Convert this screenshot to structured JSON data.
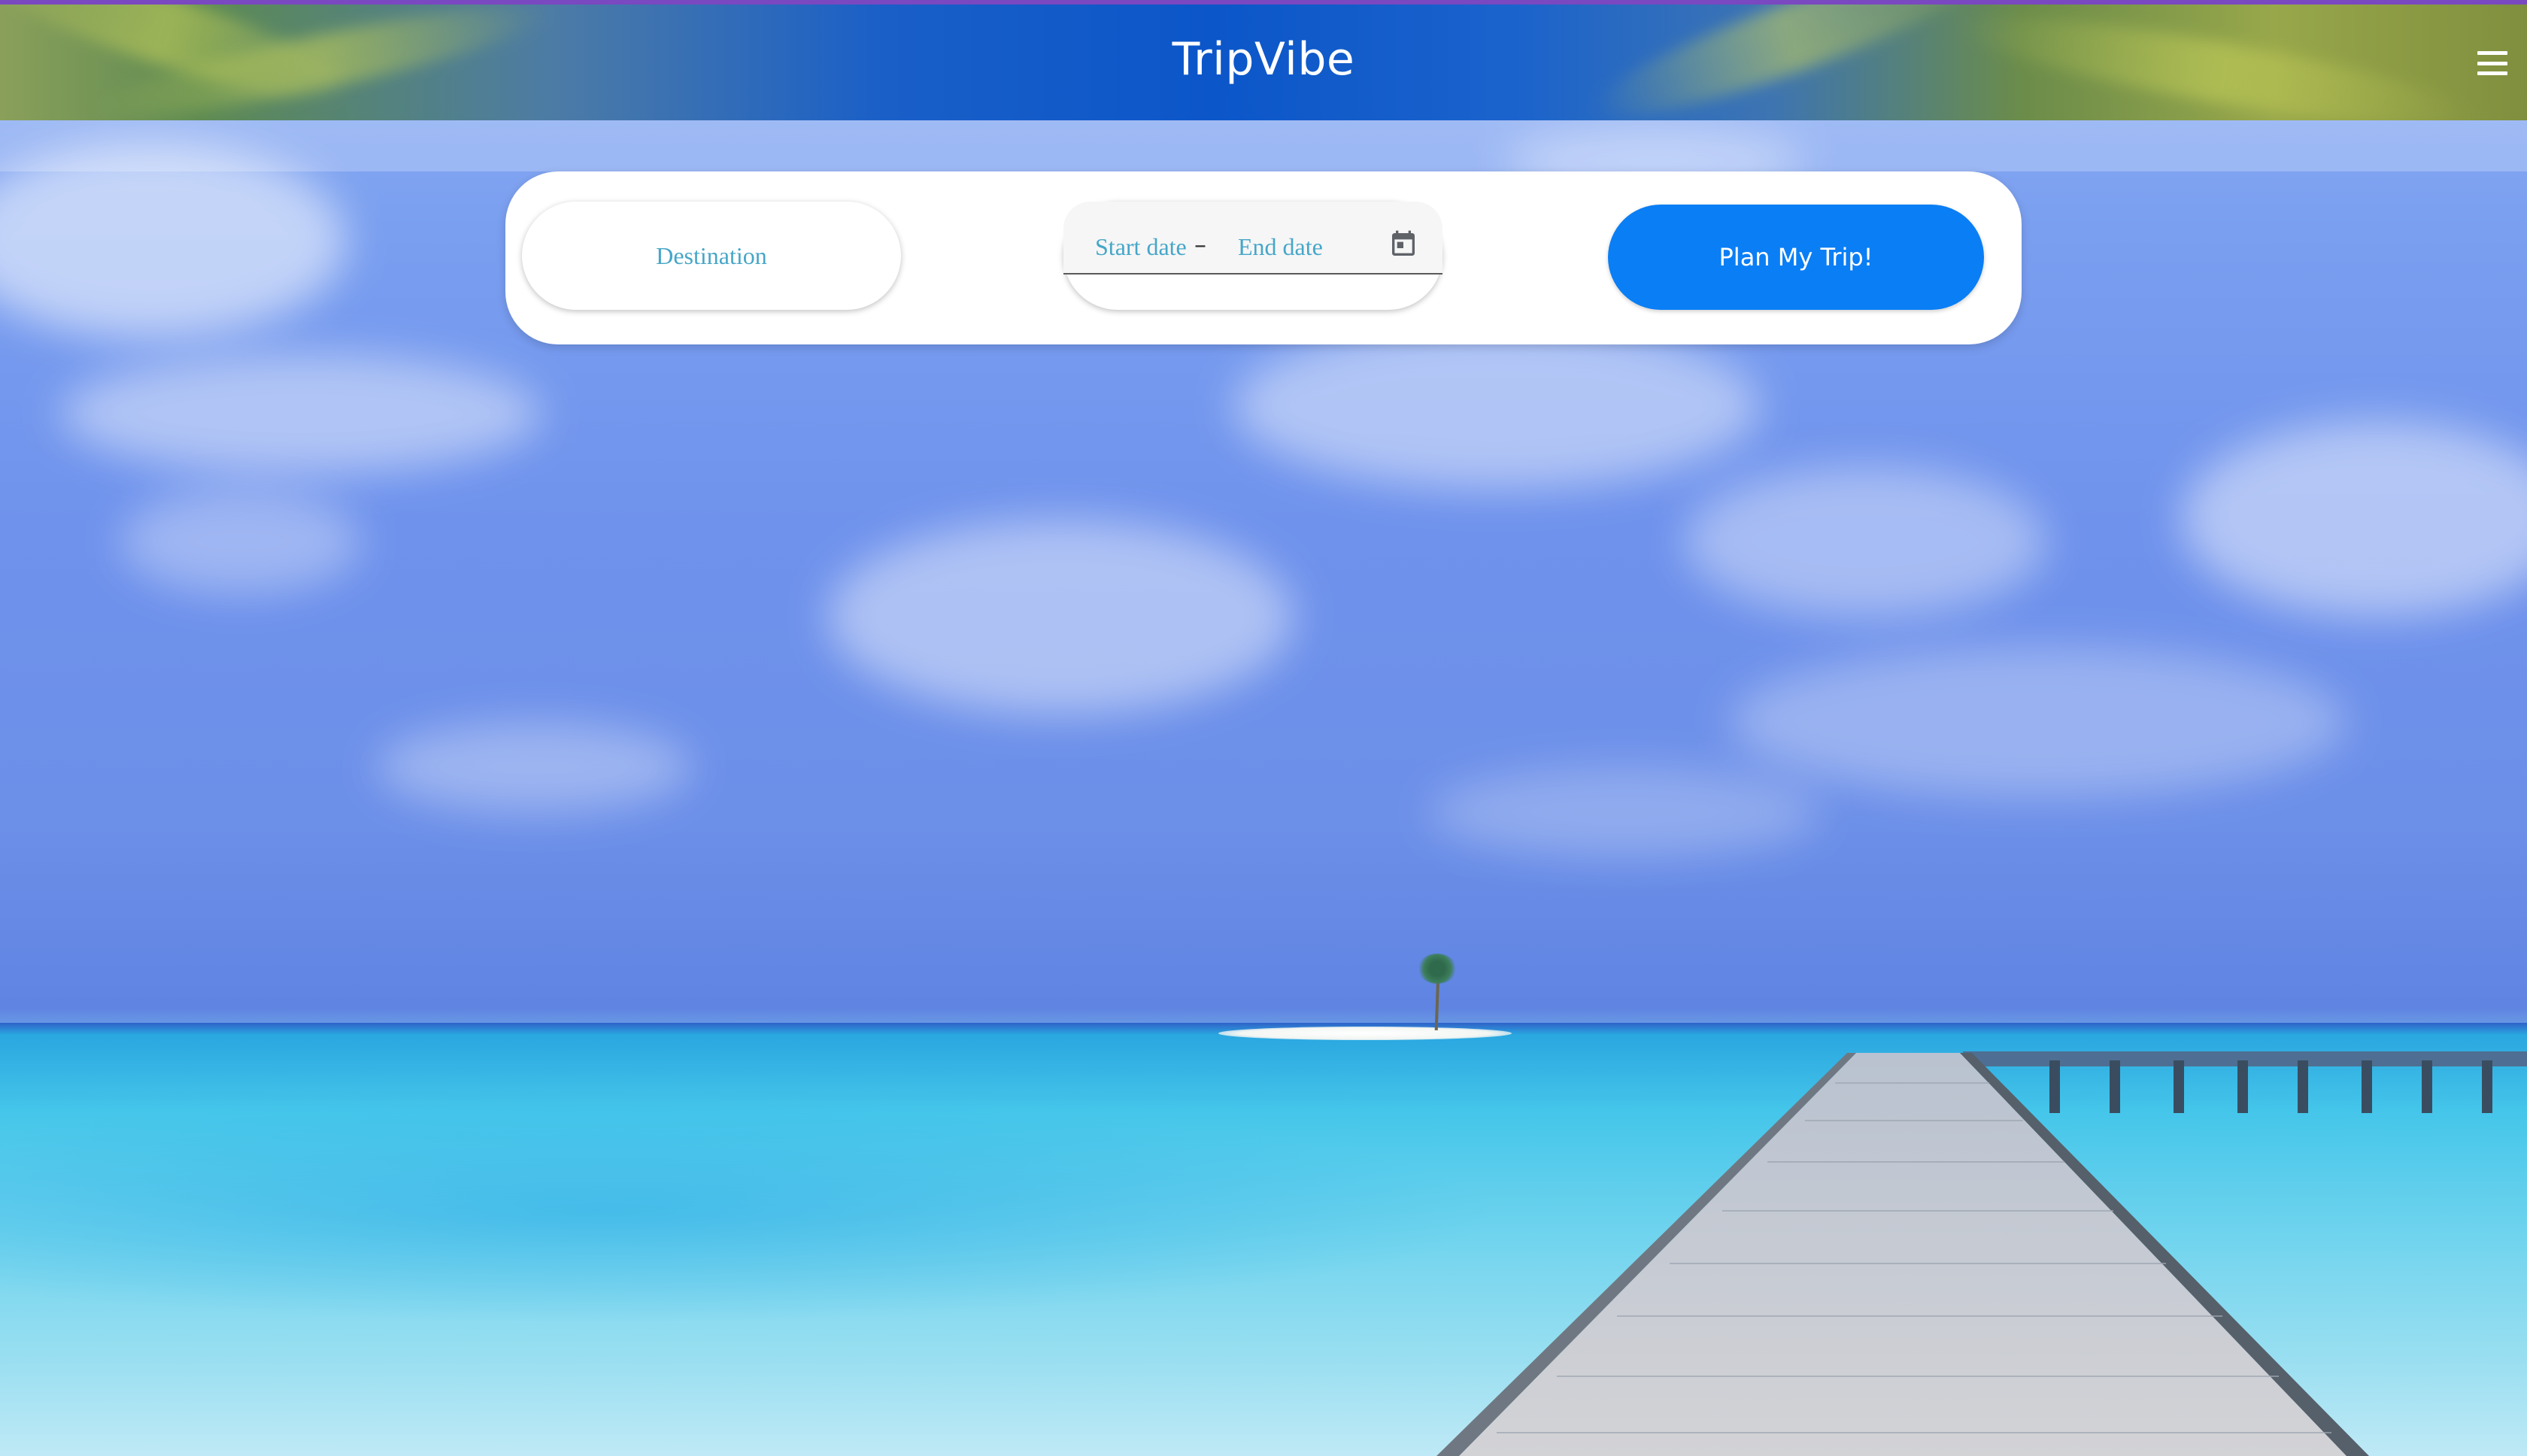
{
  "app": {
    "title": "TripVibe"
  },
  "header": {
    "menu_icon": "hamburger-menu-icon"
  },
  "search": {
    "destination_placeholder": "Destination",
    "start_date_placeholder": "Start date",
    "date_separator": "–",
    "end_date_placeholder": "End date",
    "calendar_icon": "calendar-icon",
    "submit_label": "Plan My Trip!"
  },
  "colors": {
    "accent": "#0a7ef5",
    "placeholder_text": "#46a6c8",
    "top_border": "#7a48c0"
  }
}
